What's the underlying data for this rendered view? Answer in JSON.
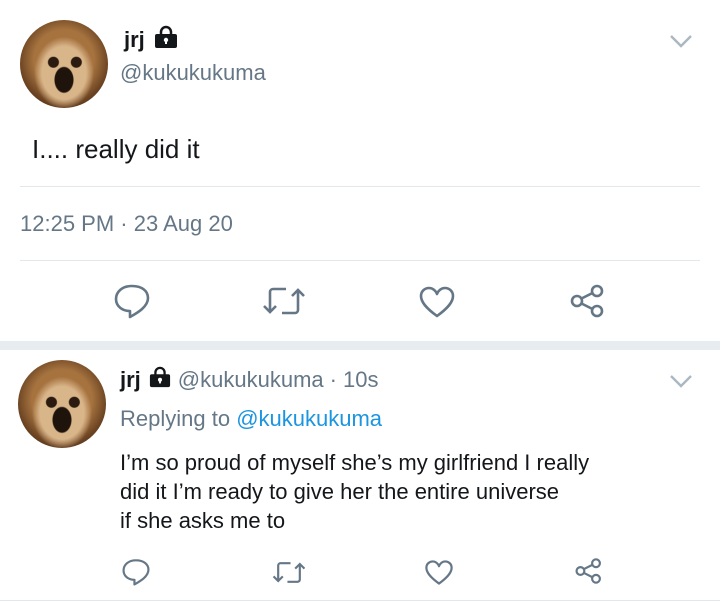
{
  "main_tweet": {
    "name": "jrj",
    "handle": "@kukukukuma",
    "text": "I.... really did it",
    "timestamp": "12:25 PM · 23 Aug 20"
  },
  "reply": {
    "name": "jrj",
    "handle": "@kukukukuma",
    "separator": "·",
    "time": "10s",
    "replying_prefix": "Replying to",
    "replying_handle": "@kukukukuma",
    "text_lines": [
      "I’m so proud of myself she’s my girlfriend I really",
      "did it I’m ready to give her the entire universe",
      "if she asks me to"
    ]
  },
  "icons": [
    "lock-icon",
    "chevron-down-icon",
    "reply-icon",
    "retweet-icon",
    "like-icon",
    "share-icon"
  ],
  "colors": {
    "text": "#14171a",
    "secondary": "#657786",
    "link": "#1b95e0",
    "icon": "#657786",
    "border": "#e1e8ed"
  }
}
